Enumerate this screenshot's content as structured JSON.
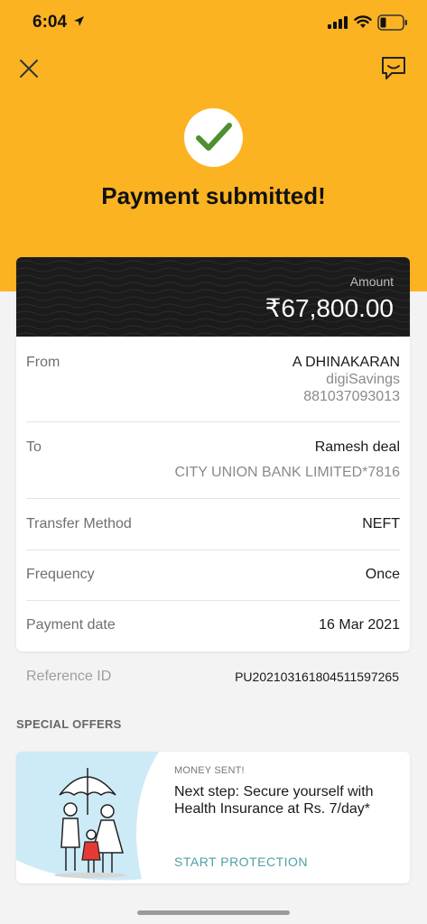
{
  "status_bar": {
    "time": "6:04",
    "icons": [
      "location-arrow-icon",
      "signal-icon",
      "wifi-icon",
      "battery-icon"
    ]
  },
  "header": {
    "close_icon": "close-icon",
    "chat_icon": "chat-icon",
    "success_icon": "checkmark-icon",
    "title": "Payment submitted!"
  },
  "amount": {
    "label": "Amount",
    "value": "₹67,800.00"
  },
  "details": {
    "from": {
      "label": "From",
      "name": "A DHINAKARAN",
      "account_type": "digiSavings",
      "account_number": "881037093013"
    },
    "to": {
      "label": "To",
      "name": "Ramesh deal",
      "bank": "CITY UNION BANK LIMITED*7816"
    },
    "transfer_method": {
      "label": "Transfer Method",
      "value": "NEFT"
    },
    "frequency": {
      "label": "Frequency",
      "value": "Once"
    },
    "payment_date": {
      "label": "Payment date",
      "value": "16 Mar 2021"
    }
  },
  "reference": {
    "label": "Reference ID",
    "value": "PU20210316180451159726​5"
  },
  "offers": {
    "heading": "SPECIAL OFFERS",
    "card": {
      "tag": "MONEY SENT!",
      "title": "Next step: Secure yourself with Health Insurance at Rs. 7/day*",
      "cta": "START PROTECTION"
    }
  },
  "colors": {
    "hero": "#fcb322",
    "check": "#4e8f2e",
    "amount_band": "#1b1b1b",
    "cta": "#4ea0a6",
    "illustration_bg": "#cdeaf7"
  }
}
